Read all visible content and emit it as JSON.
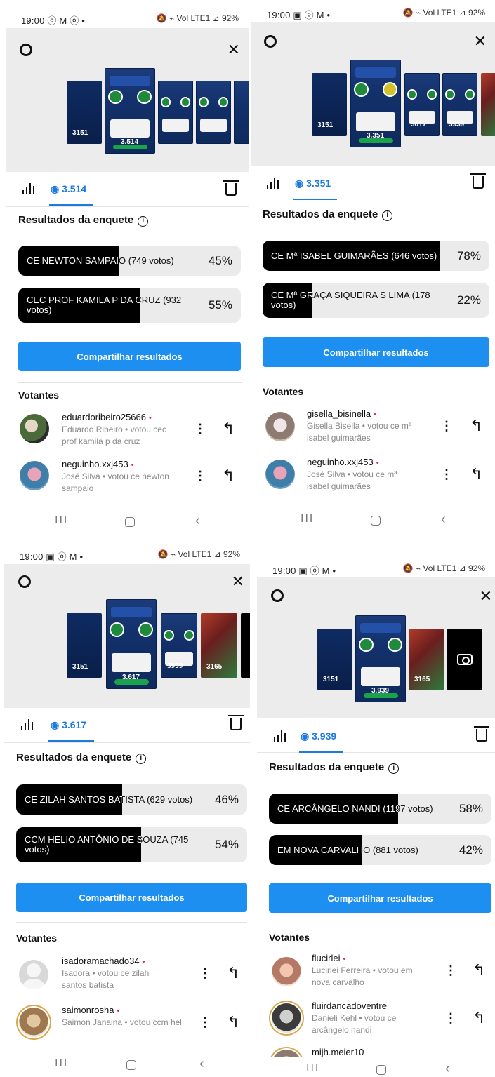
{
  "common": {
    "share_label": "Compartilhar resultados",
    "results_title": "Resultados da enquete",
    "info_glyph": "i",
    "voters_title": "Votantes",
    "kebab": "⋮",
    "reply": "↰",
    "nav_recent": "III",
    "nav_back": "‹",
    "close_glyph": "✕",
    "thumb_count": "3151"
  },
  "panels": [
    {
      "status_time": "19:00 ⓞ M ⓞ •",
      "status_right": "🔕 ⌁ Vol LTE1 ⊿ 92%",
      "views": "3.514",
      "thumb_counts": [
        "3151",
        "3.514"
      ],
      "options": [
        {
          "label": "CE NEWTON SAMPAIO (749 votos)",
          "percent": "45%",
          "fill": 0.45
        },
        {
          "label": "CEC PROF KAMILA P DA CRUZ (932 votos)",
          "percent": "55%",
          "fill": 0.55
        }
      ],
      "voters": [
        {
          "username": "eduardoribeiro25666",
          "sub": "Eduardo Ribeiro • votou cec prof kamila p da cruz"
        },
        {
          "username": "neguinho.xxj453",
          "sub": "José Silva • votou ce newton sampaio"
        }
      ]
    },
    {
      "status_time": "19:00 ▣ ⓞ M •",
      "status_right": "🔕 ⌁ Vol LTE1 ⊿ 92%",
      "views": "3.351",
      "thumb_counts": [
        "3151",
        "3.351",
        "3617",
        "3939"
      ],
      "options": [
        {
          "label": "CE Mª ISABEL GUIMARÃES (646 votos)",
          "percent": "78%",
          "fill": 0.78
        },
        {
          "label": "CE Mª GRAÇA SIQUEIRA S LIMA (178 votos)",
          "percent": "22%",
          "fill": 0.22
        }
      ],
      "voters": [
        {
          "username": "gisella_bisinella",
          "sub": "Gisella Bisella • votou ce mª isabel guimarães"
        },
        {
          "username": "neguinho.xxj453",
          "sub": "José Silva • votou ce mª isabel guimarães"
        }
      ]
    },
    {
      "status_time": "19:00 ▣ ⓞ M •",
      "status_right": "🔕 ⌁ Vol LTE1 ⊿ 92%",
      "views": "3.617",
      "thumb_counts": [
        "3151",
        "3.617",
        "3939",
        "3165"
      ],
      "options": [
        {
          "label": "CE ZILAH SANTOS BATISTA (629 votos)",
          "percent": "46%",
          "fill": 0.46
        },
        {
          "label": "CCM HELIO ANTÔNIO DE SOUZA (745 votos)",
          "percent": "54%",
          "fill": 0.54
        }
      ],
      "voters": [
        {
          "username": "isadoramachado34",
          "sub": "Isadora • votou ce zilah santos batista"
        },
        {
          "username": "saimonrosha",
          "sub": "Saimon Janaina • votou ccm helio antônio de so..."
        }
      ]
    },
    {
      "status_time": "19:00 ▣ ⓞ M •",
      "status_right": "🔕 ⌁ Vol LTE1 ⊿ 92%",
      "views": "3.939",
      "thumb_counts": [
        "3151",
        "3.939",
        "3165"
      ],
      "options": [
        {
          "label": "CE ARCÂNGELO NANDI (1197 votos)",
          "percent": "58%",
          "fill": 0.58
        },
        {
          "label": "EM NOVA CARVALHO (881 votos)",
          "percent": "42%",
          "fill": 0.42
        }
      ],
      "voters": [
        {
          "username": "flucirlei",
          "sub": "Lucirlei Ferreira • votou em nova carvalho"
        },
        {
          "username": "fluirdancadoventre",
          "sub": "Danieli Kehl • votou ce arcângelo nandi"
        },
        {
          "username": "mijh.meier10",
          "sub": ""
        }
      ]
    }
  ]
}
